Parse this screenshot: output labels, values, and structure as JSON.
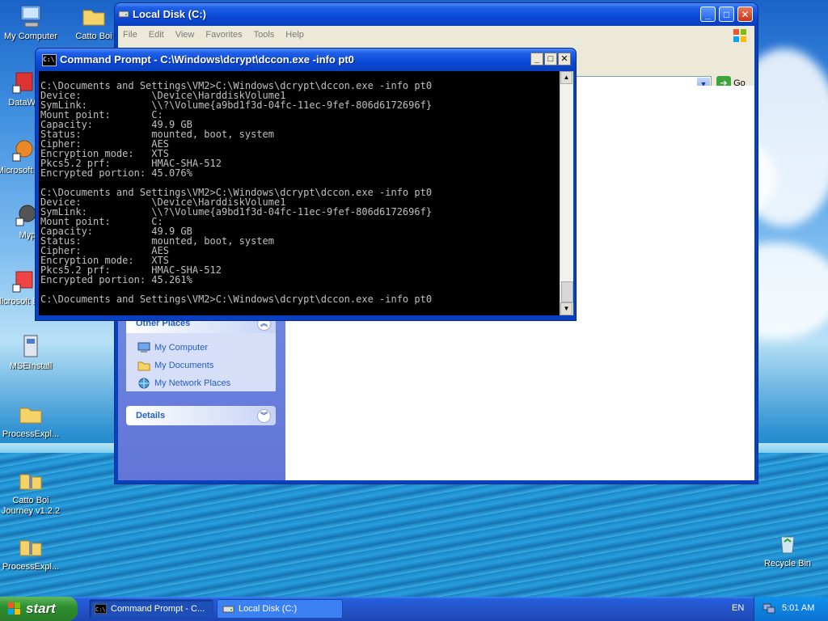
{
  "desktop": {
    "icons": [
      {
        "label": "My Computer",
        "icon": "computer-icon"
      },
      {
        "label": "Catto Boi",
        "icon": "folder-icon"
      },
      {
        "label": "DataWa",
        "icon": "shortcut-icon"
      },
      {
        "label": "Microsoft C++",
        "icon": "shortcut-icon"
      },
      {
        "label": "Myp",
        "icon": "shortcut-icon"
      },
      {
        "label": "Microsoft Basic",
        "icon": "shortcut-icon"
      },
      {
        "label": "MSEInstall",
        "icon": "installer-icon"
      },
      {
        "label": "ProcessExpl...",
        "icon": "folder-icon"
      },
      {
        "label": "Catto Boi Journey v1.2.2",
        "icon": "zip-folder-icon"
      },
      {
        "label": "ProcessExpl...",
        "icon": "zip-folder-icon"
      },
      {
        "label": "Recycle Bin",
        "icon": "recycle-bin-icon"
      }
    ]
  },
  "explorer": {
    "title": "Local Disk (C:)",
    "menu": [
      "File",
      "Edit",
      "View",
      "Favorites",
      "Tools",
      "Help"
    ],
    "go_label": "Go",
    "other_places": {
      "heading": "Other Places",
      "items": [
        "My Computer",
        "My Documents",
        "My Network Places"
      ]
    },
    "details": {
      "heading": "Details"
    }
  },
  "cmd": {
    "title": "Command Prompt - C:\\Windows\\dcrypt\\dccon.exe -info pt0",
    "output": "C:\\Documents and Settings\\VM2>C:\\Windows\\dcrypt\\dccon.exe -info pt0\nDevice:            \\Device\\HarddiskVolume1\nSymLink:           \\\\?\\Volume{a9bd1f3d-04fc-11ec-9fef-806d6172696f}\nMount point:       C:\nCapacity:          49.9 GB\nStatus:            mounted, boot, system\nCipher:            AES\nEncryption mode:   XTS\nPkcs5.2 prf:       HMAC-SHA-512\nEncrypted portion: 45.076%\n\nC:\\Documents and Settings\\VM2>C:\\Windows\\dcrypt\\dccon.exe -info pt0\nDevice:            \\Device\\HarddiskVolume1\nSymLink:           \\\\?\\Volume{a9bd1f3d-04fc-11ec-9fef-806d6172696f}\nMount point:       C:\nCapacity:          49.9 GB\nStatus:            mounted, boot, system\nCipher:            AES\nEncryption mode:   XTS\nPkcs5.2 prf:       HMAC-SHA-512\nEncrypted portion: 45.261%\n\nC:\\Documents and Settings\\VM2>C:\\Windows\\dcrypt\\dccon.exe -info pt0"
  },
  "taskbar": {
    "start_label": "start",
    "tasks": [
      {
        "label": "Command Prompt - C...",
        "icon": "cmd-icon"
      },
      {
        "label": "Local Disk (C:)",
        "icon": "drive-icon"
      }
    ],
    "language": "EN",
    "clock": "5:01 AM"
  },
  "colors": {
    "xp_blue": "#0a3fbd",
    "start_green": "#2f8f2f",
    "console_text": "#c0c0c0",
    "link_blue": "#215dc6"
  }
}
